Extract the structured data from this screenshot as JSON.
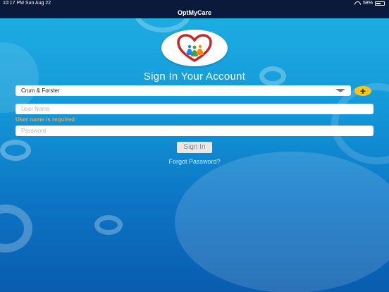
{
  "status_bar": {
    "time_date": "10:17 PM   Sun Aug 22",
    "battery": "58%",
    "battery_level": 0.58
  },
  "nav": {
    "title": "OptMyCare"
  },
  "logo": {
    "icon": "heart-family-logo",
    "colors": [
      "#c62828",
      "#1e88e5",
      "#43a047",
      "#fb8c00"
    ]
  },
  "signin": {
    "title": "Sign In Your Account",
    "company_select": {
      "value": "Crum & Forster"
    },
    "add_button": {
      "label": "+"
    },
    "username": {
      "placeholder": "User Name",
      "value": ""
    },
    "username_error": "User name is required",
    "password": {
      "placeholder": "Password",
      "value": ""
    },
    "submit_label": "Sign In",
    "forgot_label": "Forgot Password?"
  },
  "colors": {
    "background_top": "#1fb0e4",
    "background_bottom": "#0a5cae",
    "nav_bg": "#0b1a3a",
    "error": "#f4a340",
    "add_button": "#f5c518"
  }
}
